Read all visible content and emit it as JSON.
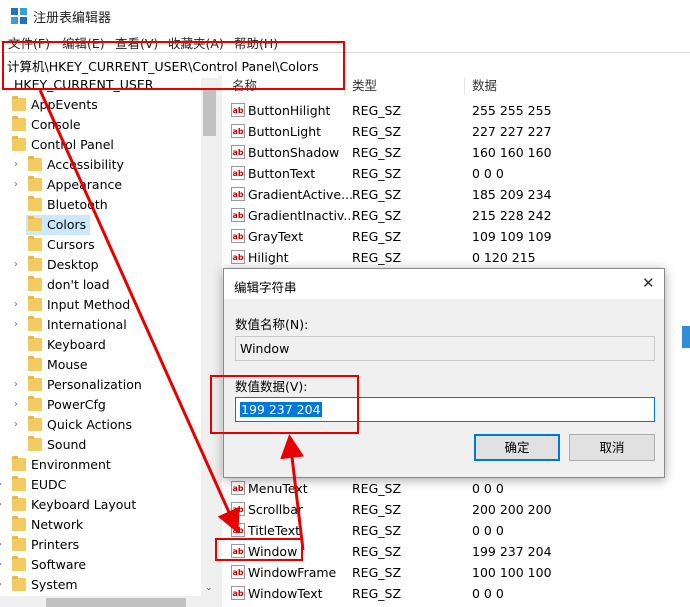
{
  "window": {
    "title": "注册表编辑器"
  },
  "menu": [
    "文件(F)",
    "编辑(E)",
    "查看(V)",
    "收藏夹(A)",
    "帮助(H)"
  ],
  "address": "计算机\\HKEY_CURRENT_USER\\Control Panel\\Colors",
  "tree": {
    "root": "HKEY_CURRENT_USER",
    "items": [
      {
        "label": "AppEvents",
        "level": 1,
        "expandable": false
      },
      {
        "label": "Console",
        "level": 1,
        "expandable": false
      },
      {
        "label": "Control Panel",
        "level": 1,
        "expandable": false
      },
      {
        "label": "Accessibility",
        "level": 2,
        "expandable": true
      },
      {
        "label": "Appearance",
        "level": 2,
        "expandable": true
      },
      {
        "label": "Bluetooth",
        "level": 2,
        "expandable": false
      },
      {
        "label": "Colors",
        "level": 2,
        "expandable": false,
        "selected": true
      },
      {
        "label": "Cursors",
        "level": 2,
        "expandable": false
      },
      {
        "label": "Desktop",
        "level": 2,
        "expandable": true
      },
      {
        "label": "don't load",
        "level": 2,
        "expandable": false
      },
      {
        "label": "Input Method",
        "level": 2,
        "expandable": true
      },
      {
        "label": "International",
        "level": 2,
        "expandable": true
      },
      {
        "label": "Keyboard",
        "level": 2,
        "expandable": false
      },
      {
        "label": "Mouse",
        "level": 2,
        "expandable": false
      },
      {
        "label": "Personalization",
        "level": 2,
        "expandable": true
      },
      {
        "label": "PowerCfg",
        "level": 2,
        "expandable": true
      },
      {
        "label": "Quick Actions",
        "level": 2,
        "expandable": true
      },
      {
        "label": "Sound",
        "level": 2,
        "expandable": false
      },
      {
        "label": "Environment",
        "level": 1,
        "expandable": false
      },
      {
        "label": "EUDC",
        "level": 1,
        "expandable": true
      },
      {
        "label": "Keyboard Layout",
        "level": 1,
        "expandable": true
      },
      {
        "label": "Network",
        "level": 1,
        "expandable": false
      },
      {
        "label": "Printers",
        "level": 1,
        "expandable": true
      },
      {
        "label": "Software",
        "level": 1,
        "expandable": true
      },
      {
        "label": "System",
        "level": 1,
        "expandable": true
      }
    ]
  },
  "list": {
    "headers": {
      "name": "名称",
      "type": "类型",
      "data": "数据"
    },
    "rows_top": [
      {
        "name": "ButtonHilight",
        "type": "REG_SZ",
        "value": "255 255 255"
      },
      {
        "name": "ButtonLight",
        "type": "REG_SZ",
        "value": "227 227 227"
      },
      {
        "name": "ButtonShadow",
        "type": "REG_SZ",
        "value": "160 160 160"
      },
      {
        "name": "ButtonText",
        "type": "REG_SZ",
        "value": "0 0 0"
      },
      {
        "name": "GradientActive...",
        "type": "REG_SZ",
        "value": "185 209 234"
      },
      {
        "name": "GradientInactiv...",
        "type": "REG_SZ",
        "value": "215 228 242"
      },
      {
        "name": "GrayText",
        "type": "REG_SZ",
        "value": "109 109 109"
      },
      {
        "name": "Hilight",
        "type": "REG_SZ",
        "value": "0 120 215"
      }
    ],
    "rows_bottom": [
      {
        "name": "MenuText",
        "type": "REG_SZ",
        "value": "0 0 0"
      },
      {
        "name": "Scrollbar",
        "type": "REG_SZ",
        "value": "200 200 200"
      },
      {
        "name": "TitleText",
        "type": "REG_SZ",
        "value": "0 0 0"
      },
      {
        "name": "Window",
        "type": "REG_SZ",
        "value": "199 237 204"
      },
      {
        "name": "WindowFrame",
        "type": "REG_SZ",
        "value": "100 100 100"
      },
      {
        "name": "WindowText",
        "type": "REG_SZ",
        "value": "0 0 0"
      }
    ]
  },
  "dialog": {
    "title": "编辑字符串",
    "name_label": "数值名称(N):",
    "name_value": "Window",
    "data_label": "数值数据(V):",
    "data_value": "199 237 204",
    "ok_label": "确定",
    "cancel_label": "取消"
  },
  "colors": {
    "annotation": "#e60000",
    "selection": "#cce8ff",
    "accent": "#0078d7"
  }
}
